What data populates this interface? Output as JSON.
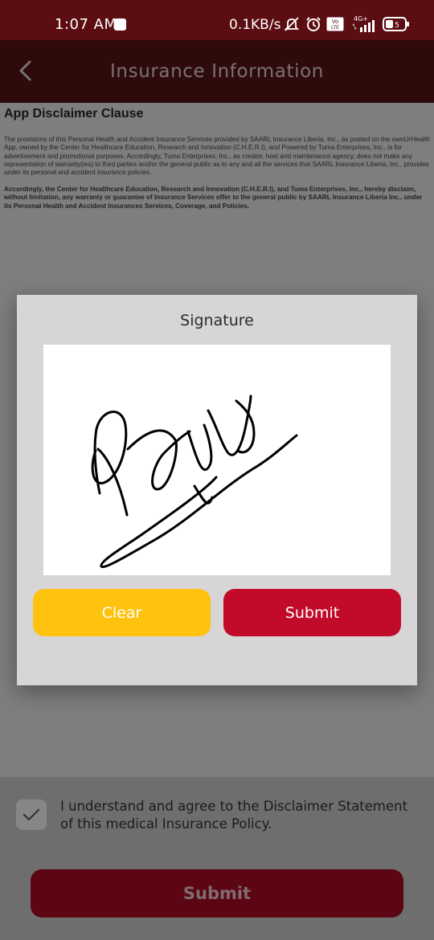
{
  "status_bar": {
    "time": "1:07 AM",
    "network_speed": "0.1KB/s",
    "network_type": "4G+",
    "volte_badge": "Vo LTE",
    "battery_level": "5",
    "icons": [
      "notification-square-icon",
      "mute-icon",
      "alarm-icon",
      "volte-icon",
      "signal-icon",
      "battery-icon"
    ]
  },
  "header": {
    "title": "Insurance Information",
    "back_icon": "chevron-left-icon"
  },
  "content": {
    "clause_title": "App Disclaimer Clause",
    "paragraph1": "The provisions of this Personal Health and Accident Insurance Services provided by SAARL Insurance Liberia, Inc., as posted on the ownUrHealth App, owned by the Center for Healthcare Education, Research and Innovation (C.H.E.R.I), and Powered by Tuma Enterprises, Inc., is for advertisement and promotional purposes. Accordingly, Tuma Enterprises, Inc., as creator, host and maintenance agency, does not make any representation of warranty(ies) to third parties and/or the general public as to any and all the services that SAARL Insurance Liberia, Inc., provides under its personal and accident insurance policies.",
    "paragraph2": "Accordingly, the Center for Healthcare Education, Research and Innovation (C.H.E.R.I), and Tuma Enterprises, Inc., hereby disclaim, without limitation, any warranty or guarantee of Insurance Services offer to the general public by SAARL Insurance Liberia Inc., under its Personal Health and Accident Insurances Services, Coverage, and Policies."
  },
  "modal": {
    "title": "Signature",
    "clear_label": "Clear",
    "submit_label": "Submit"
  },
  "agreement": {
    "checked": true,
    "text": "I understand and agree to the Disclaimer Statement of this medical Insurance Policy.",
    "submit_label": "Submit"
  },
  "colors": {
    "status_bar": "#5c0d12",
    "header": "#2f0a0b",
    "clear_button": "#ffc20e",
    "submit_button": "#c20a2b",
    "main_submit": "#5c0613"
  }
}
